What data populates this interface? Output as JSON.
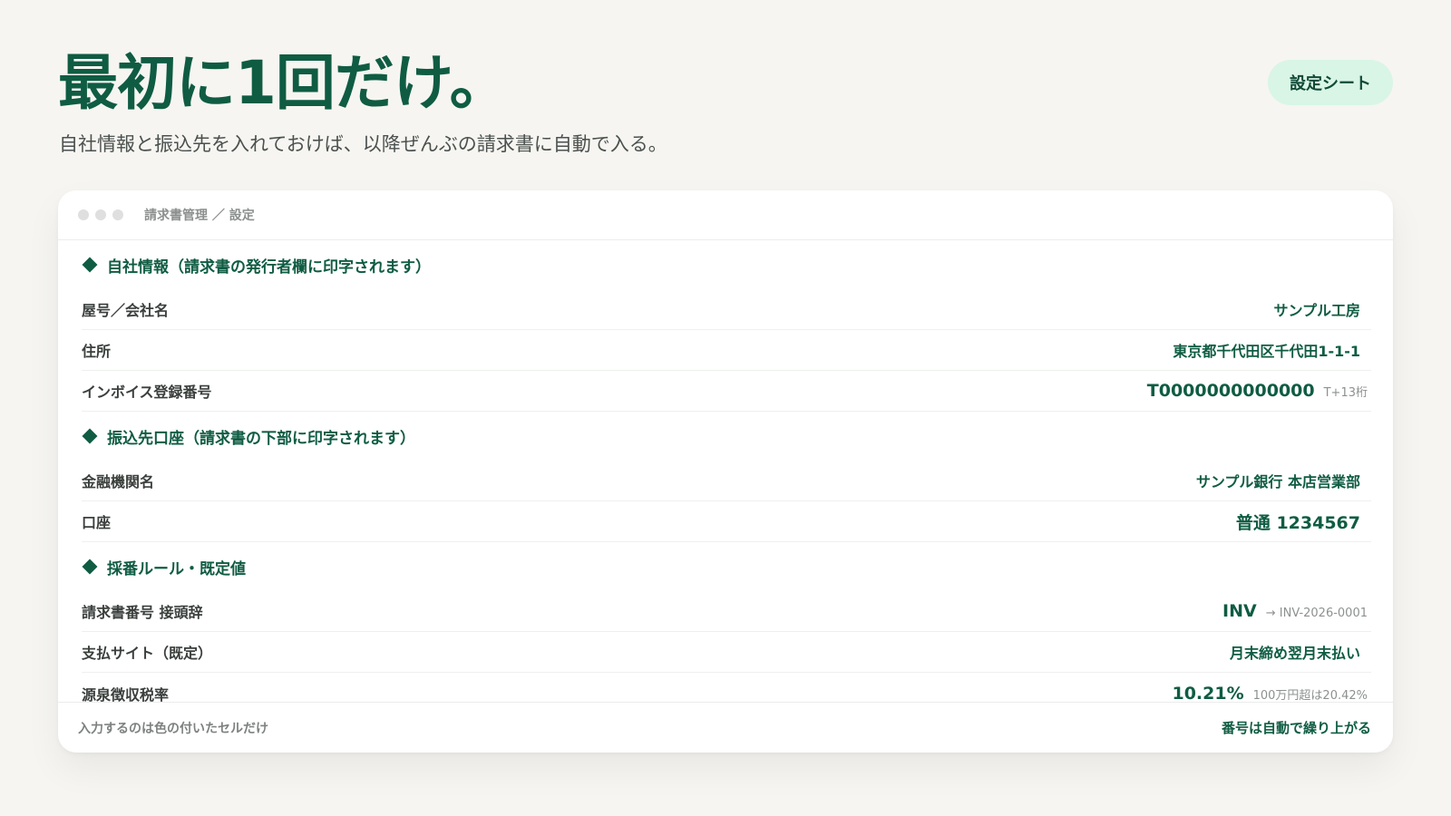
{
  "hero": {
    "title": "最初に1回だけ。",
    "subtitle": "自社情報と振込先を入れておけば、以降ぜんぶの請求書に自動で入る。",
    "badge": "設定シート"
  },
  "window": {
    "breadcrumb": "請求書管理 ／ 設定"
  },
  "sections": [
    {
      "heading": "自社情報（請求書の発行者欄に印字されます）",
      "rows": [
        {
          "label": "屋号／会社名",
          "value": "サンプル工房",
          "hint": ""
        },
        {
          "label": "住所",
          "value": "東京都千代田区千代田1-1-1",
          "hint": ""
        },
        {
          "label": "インボイス登録番号",
          "value": "T0000000000000",
          "hint": "T+13桁"
        }
      ]
    },
    {
      "heading": "振込先口座（請求書の下部に印字されます）",
      "rows": [
        {
          "label": "金融機関名",
          "value": "サンプル銀行 本店営業部",
          "hint": ""
        },
        {
          "label": "口座",
          "value": "普通 1234567",
          "hint": ""
        }
      ]
    },
    {
      "heading": "採番ルール・既定値",
      "rows": [
        {
          "label": "請求書番号 接頭辞",
          "value": "INV",
          "hint": "→ INV-2026-0001"
        },
        {
          "label": "支払サイト（既定）",
          "value": "月末締め翌月末払い",
          "hint": ""
        },
        {
          "label": "源泉徴収税率",
          "value": "10.21%",
          "hint": "100万円超は20.42%"
        }
      ]
    }
  ],
  "footer": {
    "left": "入力するのは色の付いたセルだけ",
    "right": "番号は自動で繰り上がる"
  },
  "colors": {
    "accent": "#0f5c43",
    "badge_bg": "#d9f5e6",
    "page_bg": "#f6f5f1"
  }
}
